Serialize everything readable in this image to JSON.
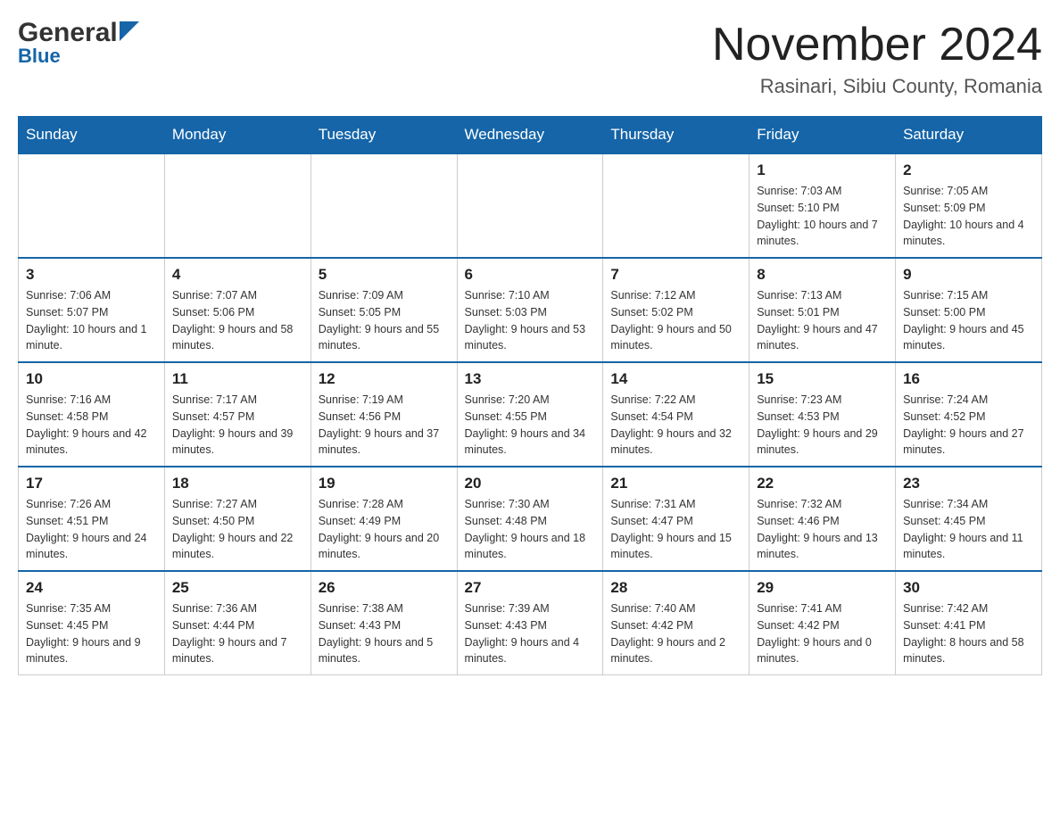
{
  "header": {
    "logo_general": "General",
    "logo_blue": "Blue",
    "month_title": "November 2024",
    "location": "Rasinari, Sibiu County, Romania"
  },
  "calendar": {
    "days_of_week": [
      "Sunday",
      "Monday",
      "Tuesday",
      "Wednesday",
      "Thursday",
      "Friday",
      "Saturday"
    ],
    "weeks": [
      [
        {
          "day": "",
          "info": ""
        },
        {
          "day": "",
          "info": ""
        },
        {
          "day": "",
          "info": ""
        },
        {
          "day": "",
          "info": ""
        },
        {
          "day": "",
          "info": ""
        },
        {
          "day": "1",
          "info": "Sunrise: 7:03 AM\nSunset: 5:10 PM\nDaylight: 10 hours and 7 minutes."
        },
        {
          "day": "2",
          "info": "Sunrise: 7:05 AM\nSunset: 5:09 PM\nDaylight: 10 hours and 4 minutes."
        }
      ],
      [
        {
          "day": "3",
          "info": "Sunrise: 7:06 AM\nSunset: 5:07 PM\nDaylight: 10 hours and 1 minute."
        },
        {
          "day": "4",
          "info": "Sunrise: 7:07 AM\nSunset: 5:06 PM\nDaylight: 9 hours and 58 minutes."
        },
        {
          "day": "5",
          "info": "Sunrise: 7:09 AM\nSunset: 5:05 PM\nDaylight: 9 hours and 55 minutes."
        },
        {
          "day": "6",
          "info": "Sunrise: 7:10 AM\nSunset: 5:03 PM\nDaylight: 9 hours and 53 minutes."
        },
        {
          "day": "7",
          "info": "Sunrise: 7:12 AM\nSunset: 5:02 PM\nDaylight: 9 hours and 50 minutes."
        },
        {
          "day": "8",
          "info": "Sunrise: 7:13 AM\nSunset: 5:01 PM\nDaylight: 9 hours and 47 minutes."
        },
        {
          "day": "9",
          "info": "Sunrise: 7:15 AM\nSunset: 5:00 PM\nDaylight: 9 hours and 45 minutes."
        }
      ],
      [
        {
          "day": "10",
          "info": "Sunrise: 7:16 AM\nSunset: 4:58 PM\nDaylight: 9 hours and 42 minutes."
        },
        {
          "day": "11",
          "info": "Sunrise: 7:17 AM\nSunset: 4:57 PM\nDaylight: 9 hours and 39 minutes."
        },
        {
          "day": "12",
          "info": "Sunrise: 7:19 AM\nSunset: 4:56 PM\nDaylight: 9 hours and 37 minutes."
        },
        {
          "day": "13",
          "info": "Sunrise: 7:20 AM\nSunset: 4:55 PM\nDaylight: 9 hours and 34 minutes."
        },
        {
          "day": "14",
          "info": "Sunrise: 7:22 AM\nSunset: 4:54 PM\nDaylight: 9 hours and 32 minutes."
        },
        {
          "day": "15",
          "info": "Sunrise: 7:23 AM\nSunset: 4:53 PM\nDaylight: 9 hours and 29 minutes."
        },
        {
          "day": "16",
          "info": "Sunrise: 7:24 AM\nSunset: 4:52 PM\nDaylight: 9 hours and 27 minutes."
        }
      ],
      [
        {
          "day": "17",
          "info": "Sunrise: 7:26 AM\nSunset: 4:51 PM\nDaylight: 9 hours and 24 minutes."
        },
        {
          "day": "18",
          "info": "Sunrise: 7:27 AM\nSunset: 4:50 PM\nDaylight: 9 hours and 22 minutes."
        },
        {
          "day": "19",
          "info": "Sunrise: 7:28 AM\nSunset: 4:49 PM\nDaylight: 9 hours and 20 minutes."
        },
        {
          "day": "20",
          "info": "Sunrise: 7:30 AM\nSunset: 4:48 PM\nDaylight: 9 hours and 18 minutes."
        },
        {
          "day": "21",
          "info": "Sunrise: 7:31 AM\nSunset: 4:47 PM\nDaylight: 9 hours and 15 minutes."
        },
        {
          "day": "22",
          "info": "Sunrise: 7:32 AM\nSunset: 4:46 PM\nDaylight: 9 hours and 13 minutes."
        },
        {
          "day": "23",
          "info": "Sunrise: 7:34 AM\nSunset: 4:45 PM\nDaylight: 9 hours and 11 minutes."
        }
      ],
      [
        {
          "day": "24",
          "info": "Sunrise: 7:35 AM\nSunset: 4:45 PM\nDaylight: 9 hours and 9 minutes."
        },
        {
          "day": "25",
          "info": "Sunrise: 7:36 AM\nSunset: 4:44 PM\nDaylight: 9 hours and 7 minutes."
        },
        {
          "day": "26",
          "info": "Sunrise: 7:38 AM\nSunset: 4:43 PM\nDaylight: 9 hours and 5 minutes."
        },
        {
          "day": "27",
          "info": "Sunrise: 7:39 AM\nSunset: 4:43 PM\nDaylight: 9 hours and 4 minutes."
        },
        {
          "day": "28",
          "info": "Sunrise: 7:40 AM\nSunset: 4:42 PM\nDaylight: 9 hours and 2 minutes."
        },
        {
          "day": "29",
          "info": "Sunrise: 7:41 AM\nSunset: 4:42 PM\nDaylight: 9 hours and 0 minutes."
        },
        {
          "day": "30",
          "info": "Sunrise: 7:42 AM\nSunset: 4:41 PM\nDaylight: 8 hours and 58 minutes."
        }
      ]
    ]
  }
}
